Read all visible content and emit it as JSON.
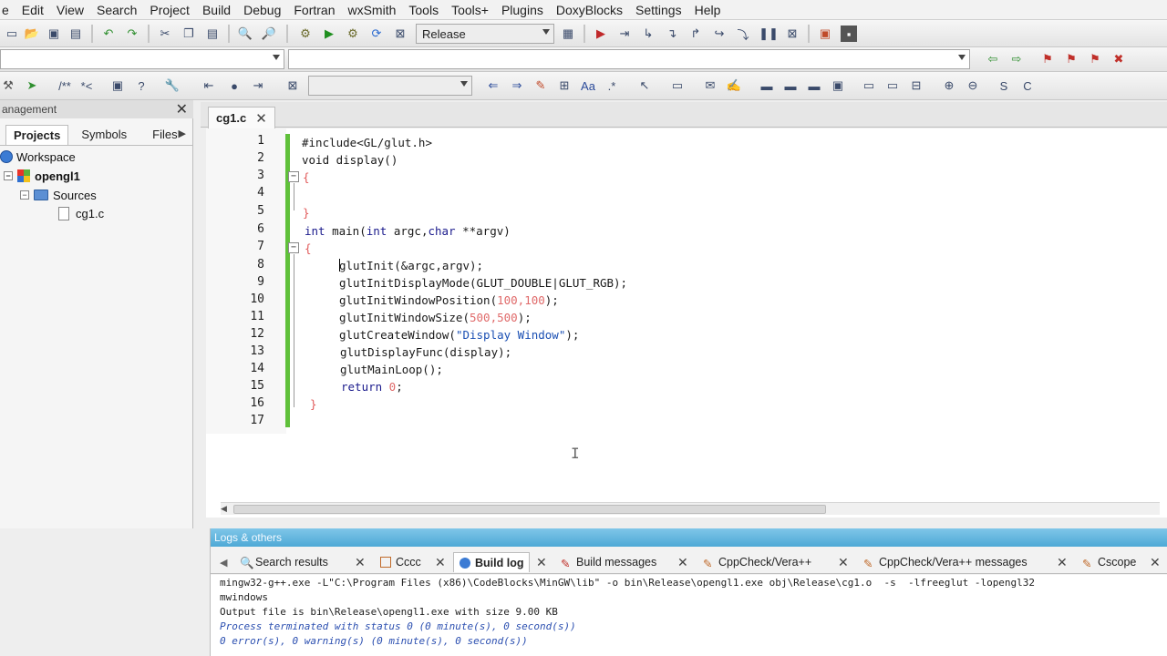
{
  "menu": [
    "e",
    "Edit",
    "View",
    "Search",
    "Project",
    "Build",
    "Debug",
    "Fortran",
    "wxSmith",
    "Tools",
    "Tools+",
    "Plugins",
    "DoxyBlocks",
    "Settings",
    "Help"
  ],
  "toolbar": {
    "build_target": "Release"
  },
  "management": {
    "title": "anagement",
    "tabs": [
      "Projects",
      "Symbols",
      "Files"
    ],
    "tree": {
      "workspace": "Workspace",
      "project": "opengl1",
      "folder": "Sources",
      "file": "cg1.c"
    }
  },
  "editor": {
    "tab_label": "cg1.c",
    "line_numbers": [
      "1",
      "2",
      "3",
      "4",
      "5",
      "6",
      "7",
      "8",
      "9",
      "10",
      "11",
      "12",
      "13",
      "14",
      "15",
      "16",
      "17"
    ],
    "code": {
      "l1": "#include<GL/glut.h>",
      "l2": "void display()",
      "l3": "{",
      "l5": "}",
      "l6_kw1": "int",
      "l6_rest1": " main(",
      "l6_kw2": "int",
      "l6_rest2": " argc,",
      "l6_kw3": "char",
      "l6_rest3": " **argv)",
      "l7": "{",
      "l8_a": "g",
      "l8_b": "lutInit(&argc,argv);",
      "l9": "glutInitDisplayMode(GLUT_DOUBLE|GLUT_RGB);",
      "l10_a": "glutInitWindowPosition(",
      "l10_num": "100,100",
      "l10_b": ");",
      "l11_a": "glutInitWindowSize(",
      "l11_num": "500,500",
      "l11_b": ");",
      "l12_a": "glutCreateWindow(",
      "l12_str": "\"Display Window\"",
      "l12_b": ");",
      "l13": "glutDisplayFunc(display);",
      "l14": "glutMainLoop();",
      "l15_kw": "return",
      "l15_num": " 0",
      "l15_b": ";",
      "l16": "}"
    }
  },
  "logs": {
    "title": "Logs & others",
    "tabs": [
      "Search results",
      "Cccc",
      "Build log",
      "Build messages",
      "CppCheck/Vera++",
      "CppCheck/Vera++ messages",
      "Cscope"
    ],
    "lines": [
      "mingw32-g++.exe -L\"C:\\Program Files (x86)\\CodeBlocks\\MinGW\\lib\" -o bin\\Release\\opengl1.exe obj\\Release\\cg1.o  -s  -lfreeglut -lopengl32",
      "mwindows",
      "Output file is bin\\Release\\opengl1.exe with size 9.00 KB",
      "Process terminated with status 0 (0 minute(s), 0 second(s))",
      "0 error(s), 0 warning(s) (0 minute(s), 0 second(s))"
    ]
  },
  "colors": {
    "line_numbers_bar": "#5fc03a",
    "keyword": "#1a1a8c",
    "number": "#e06a6a",
    "string": "#1a4fb3",
    "logs_header": "#4ea9d6",
    "log_status": "#2b4fb0"
  }
}
